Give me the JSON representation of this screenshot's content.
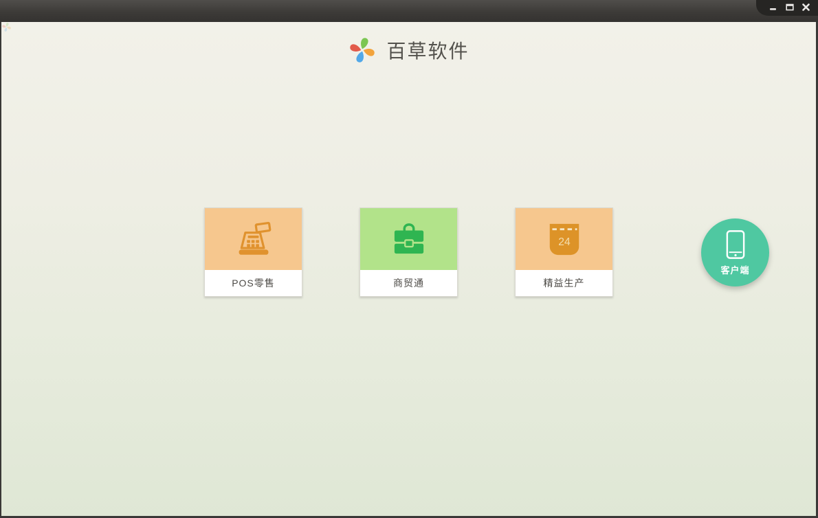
{
  "titlebar": {
    "controls": [
      {
        "name": "minimize",
        "icon": "minimize-icon"
      },
      {
        "name": "maximize",
        "icon": "maximize-icon"
      },
      {
        "name": "close",
        "icon": "close-icon"
      }
    ]
  },
  "header": {
    "app_name": "百草软件",
    "logo_icon": "pinwheel-logo-icon",
    "logo_colors": {
      "top": "#7cc653",
      "right": "#f2a33c",
      "bottom": "#52a8e8",
      "left": "#e25a4a"
    }
  },
  "products": [
    {
      "label": "POS零售",
      "icon": "cash-register-icon",
      "tile_color": "#f6c78e",
      "icon_color": "#e0922e"
    },
    {
      "label": "商贸通",
      "icon": "briefcase-icon",
      "tile_color": "#b2e38a",
      "icon_color": "#2fb551"
    },
    {
      "label": "精益生产",
      "icon": "calendar-icon",
      "tile_color": "#f6c78e",
      "icon_color": "#dd9328",
      "calendar_day": "24"
    }
  ],
  "client": {
    "label": "客户端",
    "icon": "smartphone-icon",
    "color": "#4fc8a1"
  },
  "colors": {
    "background_top": "#f2f1e9",
    "background_bottom": "#dfe7d5",
    "titlebar_top": "#504e4b",
    "titlebar_bottom": "#343230",
    "window_controls_bg": "#262523",
    "frame_border": "#393836",
    "card_label_text": "#4c4a46",
    "brand_text": "#53514c"
  }
}
